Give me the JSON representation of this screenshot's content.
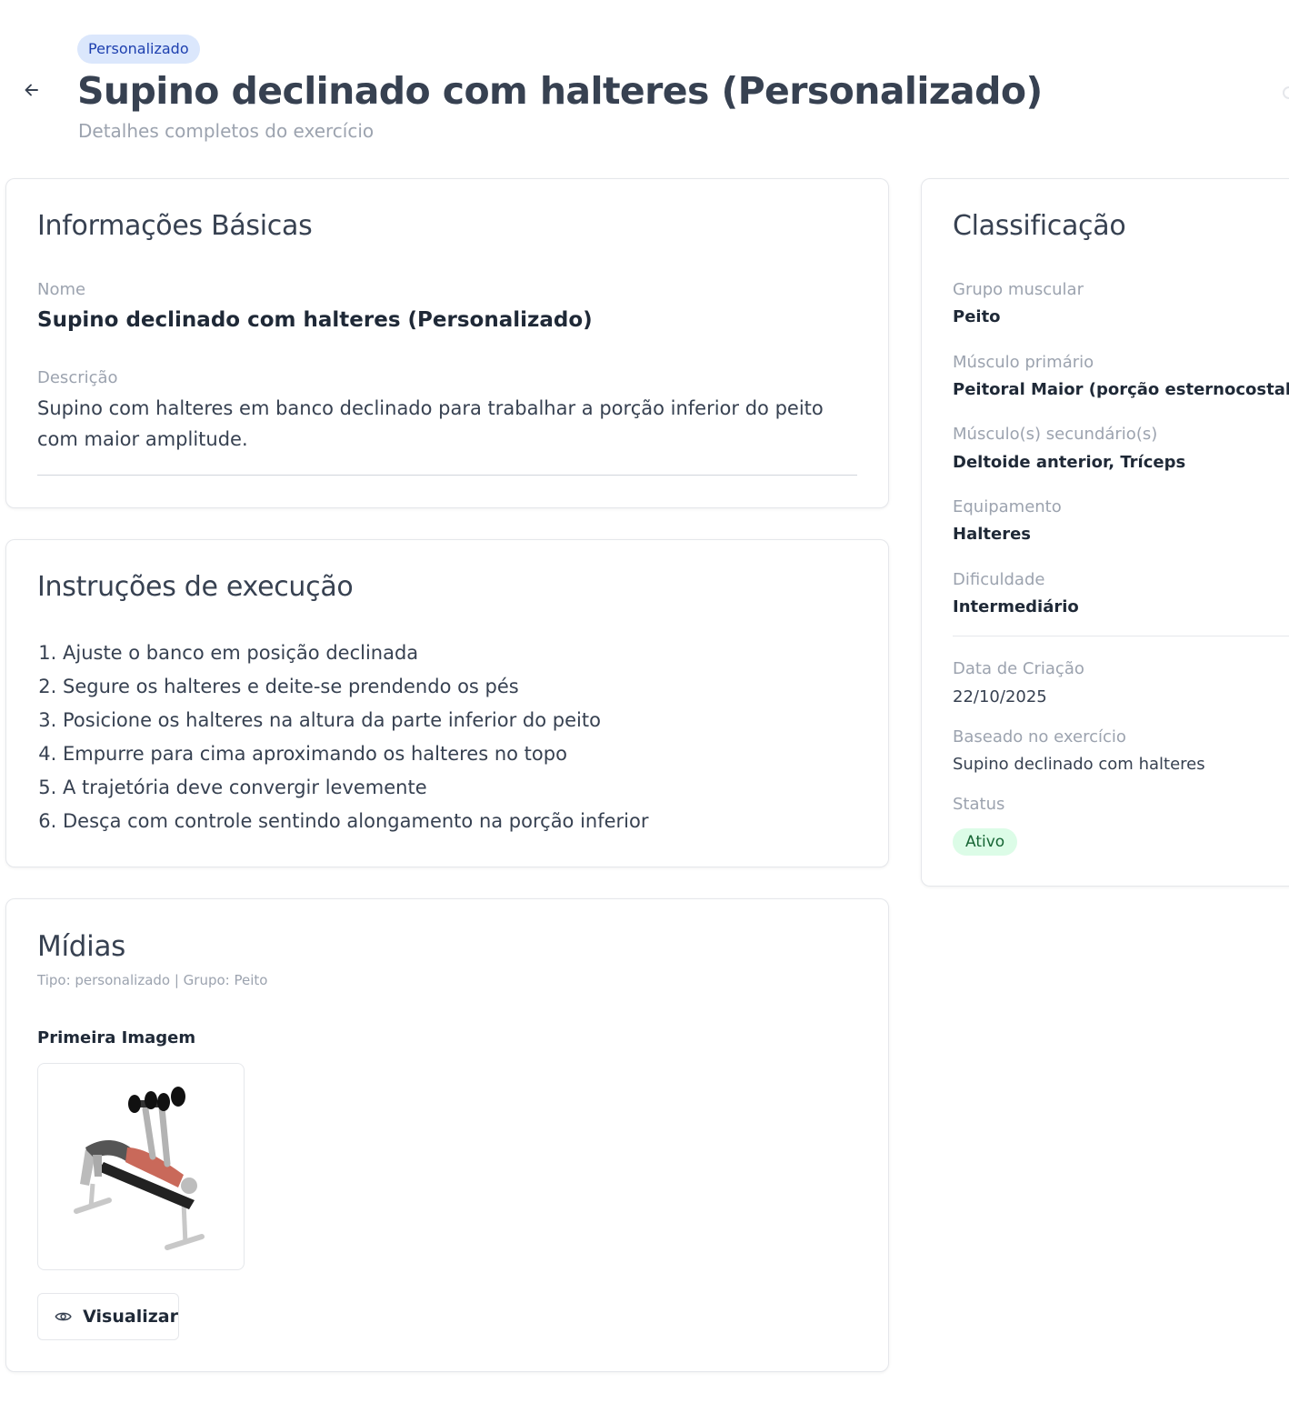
{
  "header": {
    "badge": "Personalizado",
    "title": "Supino declinado com halteres (Personalizado)",
    "subtitle": "Detalhes completos do exercício"
  },
  "basic_info": {
    "title": "Informações Básicas",
    "name_label": "Nome",
    "name_value": "Supino declinado com halteres (Personalizado)",
    "description_label": "Descrição",
    "description_value": "Supino com halteres em banco declinado para trabalhar a porção inferior do peito com maior amplitude."
  },
  "instructions": {
    "title": "Instruções de execução",
    "steps": [
      "Ajuste o banco em posição declinada",
      "Segure os halteres e deite-se prendendo os pés",
      "Posicione os halteres na altura da parte inferior do peito",
      "Empurre para cima aproximando os halteres no topo",
      "A trajetória deve convergir levemente",
      "Desça com controle sentindo alongamento na porção inferior"
    ]
  },
  "media": {
    "title": "Mídias",
    "meta": "Tipo: personalizado | Grupo: Peito",
    "first_image_label": "Primeira Imagem",
    "view_button": "Visualizar"
  },
  "classification": {
    "title": "Classificação",
    "muscle_group_label": "Grupo muscular",
    "muscle_group_value": "Peito",
    "primary_muscle_label": "Músculo primário",
    "primary_muscle_value": "Peitoral Maior (porção esternocostal)",
    "secondary_muscles_label": "Músculo(s) secundário(s)",
    "secondary_muscles_value": "Deltoide anterior, Tríceps",
    "equipment_label": "Equipamento",
    "equipment_value": "Halteres",
    "difficulty_label": "Dificuldade",
    "difficulty_value": "Intermediário",
    "created_label": "Data de Criação",
    "created_value": "22/10/2025",
    "based_on_label": "Baseado no exercício",
    "based_on_value": "Supino declinado com halteres",
    "status_label": "Status",
    "status_value": "Ativo"
  },
  "icons": {
    "back": "arrow-left-icon",
    "view": "eye-icon"
  },
  "colors": {
    "badge_bg": "#dbe7fc",
    "badge_text": "#1e40af",
    "status_bg": "#dcfce7",
    "status_text": "#166534",
    "muted_text": "#9ca3af",
    "main_text": "#374151"
  }
}
